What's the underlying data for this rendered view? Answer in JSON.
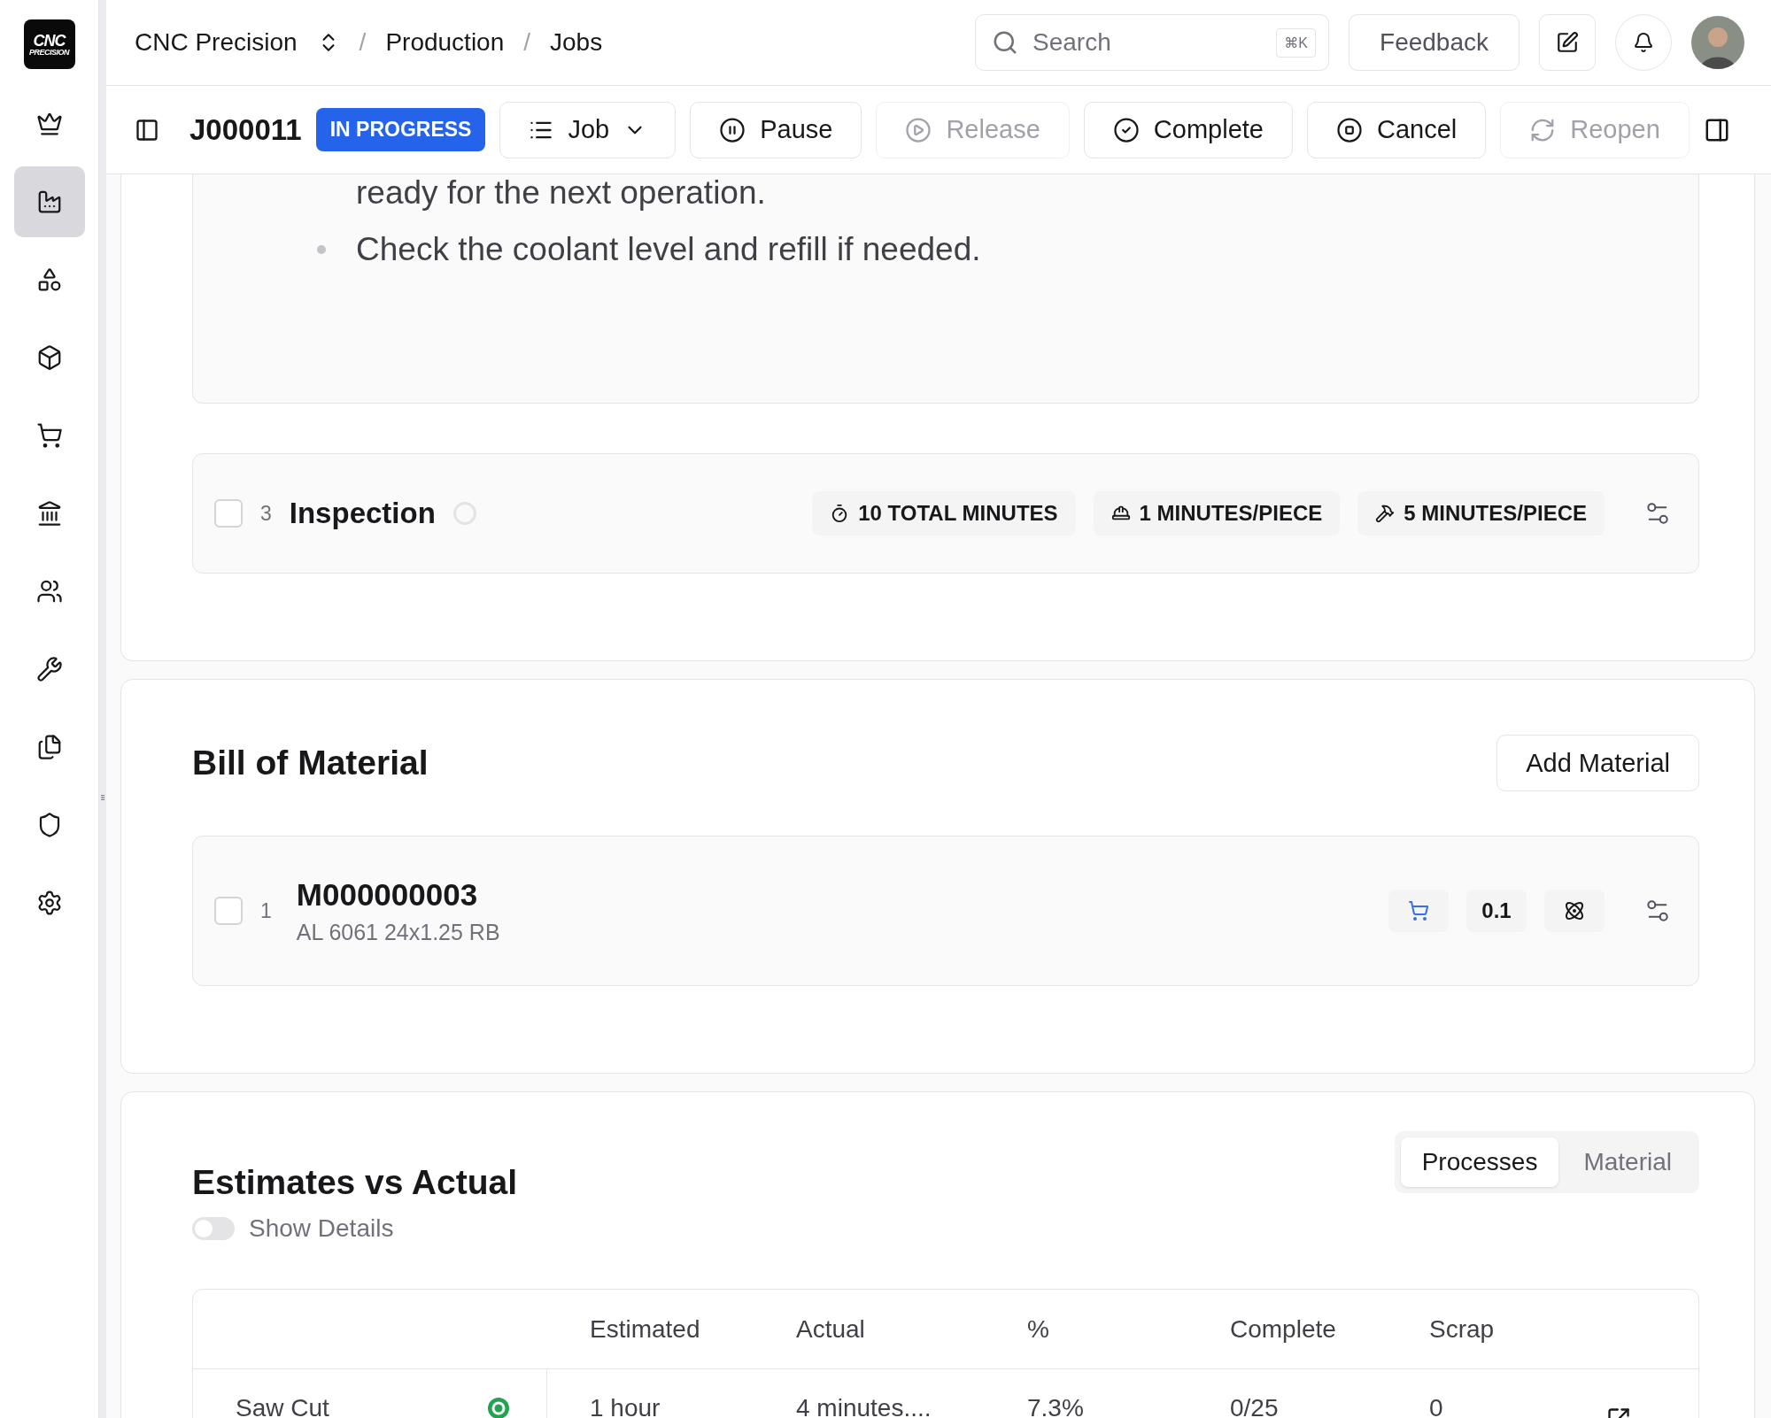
{
  "logo": {
    "line1": "CNC",
    "line2": "PRECISION"
  },
  "breadcrumb": {
    "company": "CNC Precision",
    "items": [
      {
        "separator": "/",
        "label": "Production"
      },
      {
        "separator": "/",
        "label": "Jobs"
      }
    ]
  },
  "search": {
    "placeholder": "Search",
    "shortcut": "⌘K"
  },
  "feedback": "Feedback",
  "sidebar": {
    "items": [
      {
        "kind": "crown",
        "selected": false
      },
      {
        "kind": "factory",
        "selected": true
      },
      {
        "kind": "shapes",
        "selected": false
      },
      {
        "kind": "box",
        "selected": false
      },
      {
        "kind": "cart",
        "selected": false
      },
      {
        "kind": "bank",
        "selected": false
      },
      {
        "kind": "users",
        "selected": false
      },
      {
        "kind": "wrench",
        "selected": false
      },
      {
        "kind": "files",
        "selected": false
      },
      {
        "kind": "shield",
        "selected": false
      },
      {
        "kind": "settings",
        "selected": false
      }
    ]
  },
  "job": {
    "id": "J000011",
    "status": "IN PROGRESS",
    "menu": "Job"
  },
  "actions": [
    {
      "kind": "pause",
      "label": "Pause",
      "disabled": false
    },
    {
      "kind": "play",
      "label": "Release",
      "disabled": true
    },
    {
      "kind": "check",
      "label": "Complete",
      "disabled": false
    },
    {
      "kind": "stop",
      "label": "Cancel",
      "disabled": false
    },
    {
      "kind": "refresh",
      "label": "Reopen",
      "disabled": true
    }
  ],
  "instructions": {
    "lines": [
      {
        "text": "ready for the next operation.",
        "bullet": false
      },
      {
        "text": "Check the coolant level and refill if needed.",
        "bullet": true
      }
    ]
  },
  "operation": {
    "checked": false,
    "number": "3",
    "name": "Inspection",
    "tags": [
      {
        "kind": "timer",
        "label": "10 TOTAL MINUTES"
      },
      {
        "kind": "hardhat",
        "label": "1 MINUTES/PIECE"
      },
      {
        "kind": "hammer",
        "label": "5 MINUTES/PIECE"
      }
    ]
  },
  "bill_of_material": {
    "title": "Bill of Material",
    "button": "Add Material",
    "items": [
      {
        "checked": false,
        "number": "1",
        "id": "M000000003",
        "description": "AL 6061 24x1.25 RB",
        "quantity": "0.1"
      }
    ]
  },
  "estimates": {
    "title": "Estimates vs Actual",
    "show_details": {
      "label": "Show Details",
      "on": false
    },
    "tabs": [
      {
        "label": "Processes",
        "selected": true
      },
      {
        "label": "Material",
        "selected": false
      }
    ],
    "columns": [
      "Estimated",
      "Actual",
      "%",
      "Complete",
      "Scrap"
    ],
    "rows": [
      {
        "name": "Saw Cut",
        "estimated": "1 hour",
        "actual": "4 minutes....",
        "percent": "7.3%",
        "complete": "0/25",
        "scrap": "0"
      }
    ]
  }
}
